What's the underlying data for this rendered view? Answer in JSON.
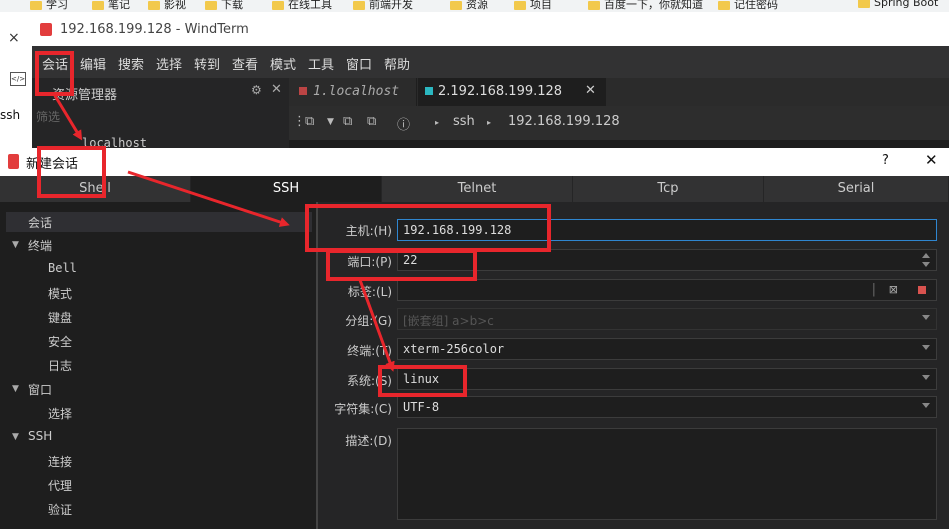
{
  "bookmarks": [
    "学习",
    "笔记",
    "影视",
    "下载",
    "在线工具",
    "前端开发",
    "资源",
    "项目",
    "百度一下，你就知道",
    "记住密码",
    "Spring Boot"
  ],
  "browser": {
    "close": "×",
    "ext": "</>",
    "partial_text": "ssh"
  },
  "window": {
    "title": "192.168.199.128 - WindTerm"
  },
  "menu": [
    "会话",
    "编辑",
    "搜索",
    "选择",
    "转到",
    "查看",
    "模式",
    "工具",
    "窗口",
    "帮助"
  ],
  "resource_panel": {
    "title": "资源管理器",
    "filter": "筛选",
    "host_partial": "localhost"
  },
  "tabs": [
    {
      "label": "1.localhost"
    },
    {
      "label": "2.192.168.199.128"
    }
  ],
  "breadcrumb": {
    "protocol": "ssh",
    "host": "192.168.199.128"
  },
  "dialog": {
    "title": "新建会话",
    "help": "?",
    "protocols": [
      "Shell",
      "SSH",
      "Telnet",
      "Tcp",
      "Serial"
    ],
    "active_protocol": "SSH",
    "tree": [
      {
        "label": "会话",
        "level": 0,
        "selected": true
      },
      {
        "label": "终端",
        "level": 0,
        "expanded": true
      },
      {
        "label": "Bell",
        "level": 1
      },
      {
        "label": "模式",
        "level": 1
      },
      {
        "label": "键盘",
        "level": 1
      },
      {
        "label": "安全",
        "level": 1
      },
      {
        "label": "日志",
        "level": 1
      },
      {
        "label": "窗口",
        "level": 0,
        "expanded": true
      },
      {
        "label": "选择",
        "level": 1
      },
      {
        "label": "SSH",
        "level": 0,
        "expanded": true
      },
      {
        "label": "连接",
        "level": 1
      },
      {
        "label": "代理",
        "level": 1
      },
      {
        "label": "验证",
        "level": 1
      }
    ],
    "fields": {
      "host": {
        "label": "主机:(H)",
        "value": "192.168.199.128"
      },
      "port": {
        "label": "端口:(P)",
        "value": "22"
      },
      "tag": {
        "label": "标签:(L)",
        "value": ""
      },
      "group": {
        "label": "分组:(G)",
        "placeholder": "[嵌套组] a>b>c"
      },
      "terminal": {
        "label": "终端:(T)",
        "value": "xterm-256color"
      },
      "system": {
        "label": "系统:(S)",
        "value": "linux"
      },
      "charset": {
        "label": "字符集:(C)",
        "value": "UTF-8"
      },
      "description": {
        "label": "描述:(D)",
        "value": ""
      }
    }
  },
  "colors": {
    "annotation": "#e8262c",
    "accent_tab": "#2bb7c0",
    "focus": "#2f86d0"
  }
}
